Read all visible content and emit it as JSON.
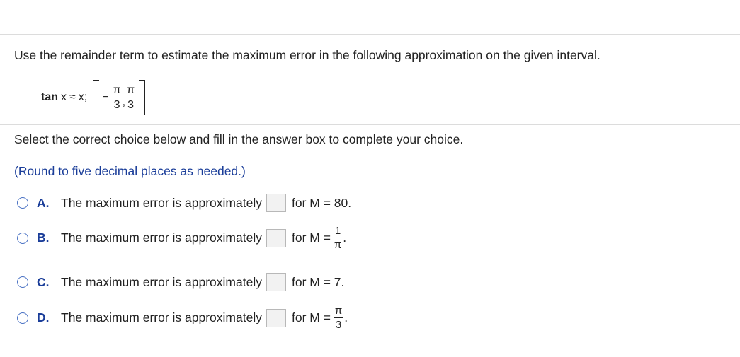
{
  "question": {
    "text": "Use the remainder term to estimate the maximum error in the following approximation on the given interval."
  },
  "formula": {
    "function": "tan",
    "var": "x",
    "approx": "≈",
    "rhs": "x;",
    "interval_left_sign": "−",
    "interval_left_num": "π",
    "interval_left_den": "3",
    "interval_sep": ",",
    "interval_right_num": "π",
    "interval_right_den": "3"
  },
  "instruction": "Select the correct choice below and fill in the answer box to complete your choice.",
  "round_note": "(Round to five decimal places as needed.)",
  "choices": [
    {
      "letter": "A.",
      "text": "The maximum error is approximately",
      "answer": "",
      "m_prefix": "for M = 80."
    },
    {
      "letter": "B.",
      "text": "The maximum error is approximately",
      "answer": "",
      "m_prefix": "for M =",
      "m_num": "1",
      "m_den": "π",
      "m_suffix": "."
    },
    {
      "letter": "C.",
      "text": "The maximum error is approximately",
      "answer": "",
      "m_prefix": "for M = 7."
    },
    {
      "letter": "D.",
      "text": "The maximum error is approximately",
      "answer": "",
      "m_prefix": "for M =",
      "m_num": "π",
      "m_den": "3",
      "m_suffix": "."
    }
  ]
}
